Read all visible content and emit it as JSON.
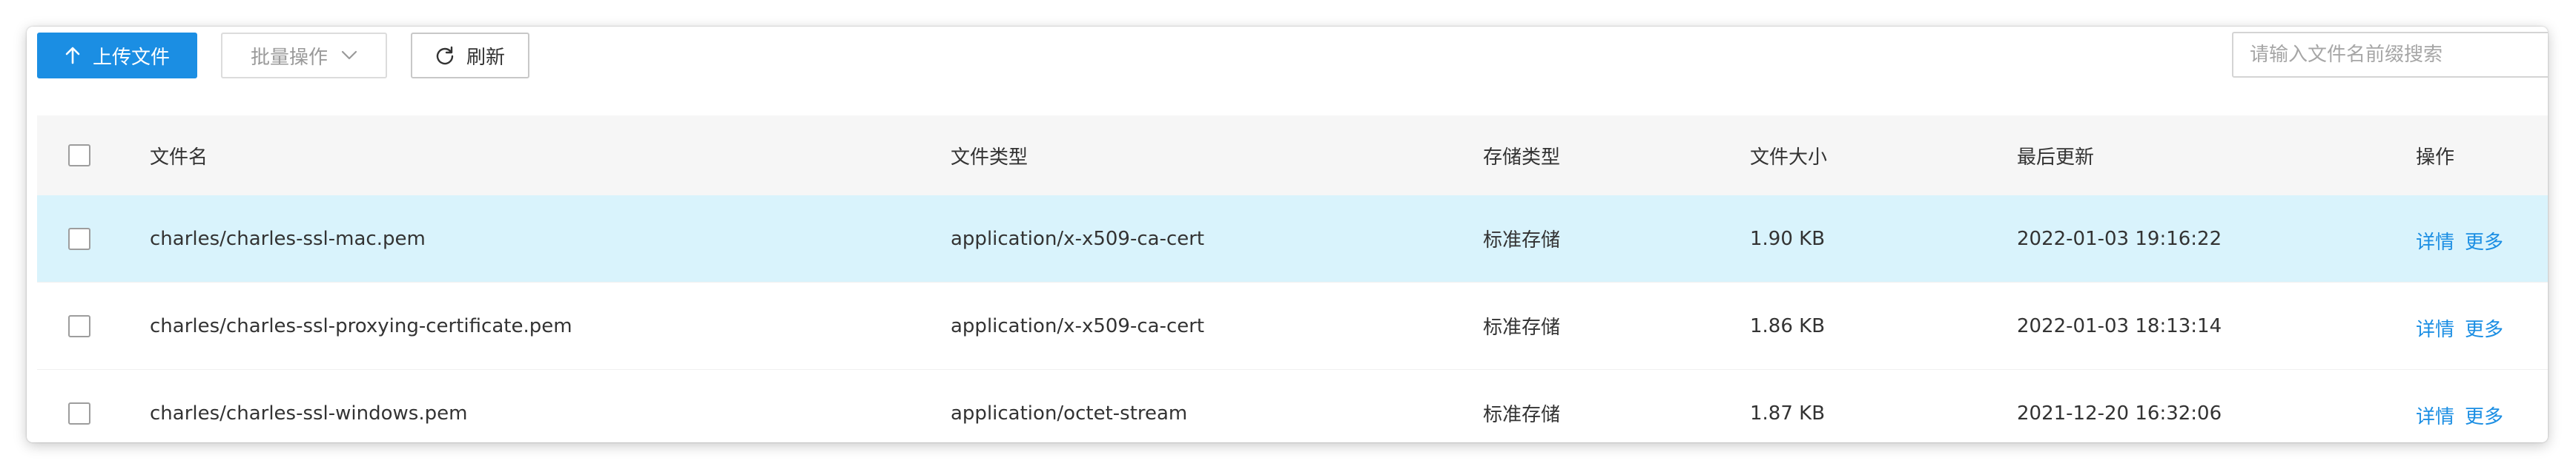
{
  "toolbar": {
    "upload_label": "上传文件",
    "batch_label": "批量操作",
    "refresh_label": "刷新"
  },
  "search": {
    "placeholder": "请输入文件名前缀搜索",
    "value": ""
  },
  "table": {
    "headers": {
      "name": "文件名",
      "type": "文件类型",
      "storage": "存储类型",
      "size": "文件大小",
      "updated": "最后更新",
      "actions": "操作"
    },
    "rows": [
      {
        "name": "charles/charles-ssl-mac.pem",
        "type": "application/x-x509-ca-cert",
        "storage": "标准存储",
        "size": "1.90 KB",
        "updated": "2022-01-03 19:16:22",
        "detail": "详情",
        "more": "更多",
        "selected": true
      },
      {
        "name": "charles/charles-ssl-proxying-certificate.pem",
        "type": "application/x-x509-ca-cert",
        "storage": "标准存储",
        "size": "1.86 KB",
        "updated": "2022-01-03 18:13:14",
        "detail": "详情",
        "more": "更多",
        "selected": false
      },
      {
        "name": "charles/charles-ssl-windows.pem",
        "type": "application/octet-stream",
        "storage": "标准存储",
        "size": "1.87 KB",
        "updated": "2021-12-20 16:32:06",
        "detail": "详情",
        "more": "更多",
        "selected": false
      }
    ]
  },
  "colors": {
    "accent": "#1b8ee3",
    "selected_row": "#d9f3fc",
    "header_bg": "#f6f6f6"
  },
  "icons": {
    "upload": "arrow-up-icon",
    "batch": "chevron-down-icon",
    "refresh": "refresh-icon"
  }
}
